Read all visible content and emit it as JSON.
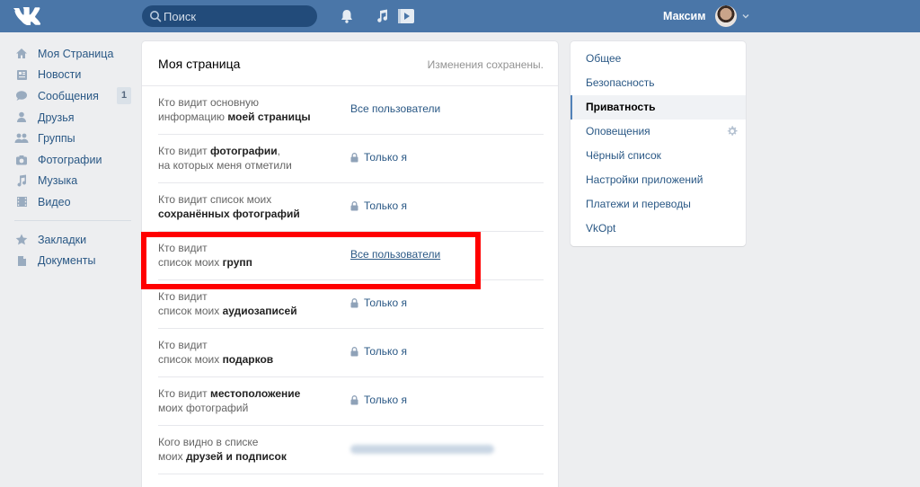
{
  "header": {
    "search_placeholder": "Поиск",
    "user_name": "Максим"
  },
  "sidebar": {
    "items": [
      {
        "label": "Моя Страница",
        "icon": "home-icon"
      },
      {
        "label": "Новости",
        "icon": "news-icon"
      },
      {
        "label": "Сообщения",
        "icon": "messages-icon",
        "badge": "1"
      },
      {
        "label": "Друзья",
        "icon": "friend-icon"
      },
      {
        "label": "Группы",
        "icon": "groups-icon"
      },
      {
        "label": "Фотографии",
        "icon": "camera-icon"
      },
      {
        "label": "Музыка",
        "icon": "music-icon"
      },
      {
        "label": "Видео",
        "icon": "video-icon"
      }
    ],
    "items2": [
      {
        "label": "Закладки",
        "icon": "star-icon"
      },
      {
        "label": "Документы",
        "icon": "document-icon"
      }
    ]
  },
  "main": {
    "title": "Моя страница",
    "status": "Изменения сохранены.",
    "rows": [
      {
        "q1": "Кто видит основную",
        "q2a": "информацию ",
        "q2b": "моей страницы",
        "value": "Все пользователи",
        "locked": false
      },
      {
        "q1a": "Кто видит ",
        "q1b": "фотографии",
        "q1c": ",",
        "q2": "на которых меня отметили",
        "value": "Только я",
        "locked": true
      },
      {
        "q1": "Кто видит список моих",
        "q2b": "сохранённых фотографий",
        "value": "Только я",
        "locked": true
      },
      {
        "q1": "Кто видит",
        "q2a": "список моих ",
        "q2b": "групп",
        "value": "Все пользователи",
        "locked": false
      },
      {
        "q1": "Кто видит",
        "q2a": "список моих ",
        "q2b": "аудиозаписей",
        "value": "Только я",
        "locked": true
      },
      {
        "q1": "Кто видит",
        "q2a": "список моих ",
        "q2b": "подарков",
        "value": "Только я",
        "locked": true
      },
      {
        "q1a": "Кто видит ",
        "q1b": "местоположение",
        "q2": "моих фотографий",
        "value": "Только я",
        "locked": true
      },
      {
        "q1": "Кого видно в списке",
        "q2a": "моих ",
        "q2b": "друзей и подписок"
      }
    ]
  },
  "rightmenu": {
    "items": [
      {
        "label": "Общее"
      },
      {
        "label": "Безопасность"
      },
      {
        "label": "Приватность",
        "active": true
      },
      {
        "label": "Оповещения"
      },
      {
        "label": "Чёрный список"
      },
      {
        "label": "Настройки приложений"
      },
      {
        "label": "Платежи и переводы"
      },
      {
        "label": "VkOpt"
      }
    ]
  },
  "colors": {
    "header_bg": "#4a76a8",
    "link": "#2a5885",
    "highlight": "#ff0000"
  }
}
